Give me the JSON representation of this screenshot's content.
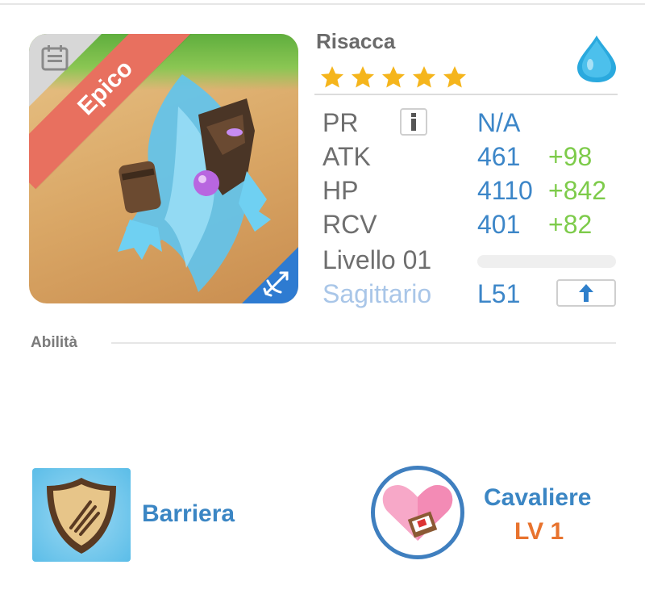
{
  "monster": {
    "name": "Risacca",
    "rarity": "Epico",
    "stars": 5,
    "element_icon": "water-drop-icon",
    "class_icon": "bow-arrow-icon"
  },
  "stats": {
    "pr_label": "PR",
    "pr_value": "N/A",
    "atk_label": "ATK",
    "atk_value": "461",
    "atk_bonus": "+98",
    "hp_label": "HP",
    "hp_value": "4110",
    "hp_bonus": "+842",
    "rcv_label": "RCV",
    "rcv_value": "401",
    "rcv_bonus": "+82",
    "level_label": "Livello 01",
    "level_progress": 0,
    "zodiac_label": "Sagittario",
    "zodiac_level": "L51"
  },
  "abilities": {
    "section_title": "Abilità",
    "ability_name": "Barriera",
    "skill_name": "Cavaliere",
    "skill_level": "LV 1"
  },
  "colors": {
    "accent_blue": "#3c86c8",
    "bonus_green": "#7dcb4a",
    "rarity_red": "#e8705f",
    "level_orange": "#e8732e"
  }
}
